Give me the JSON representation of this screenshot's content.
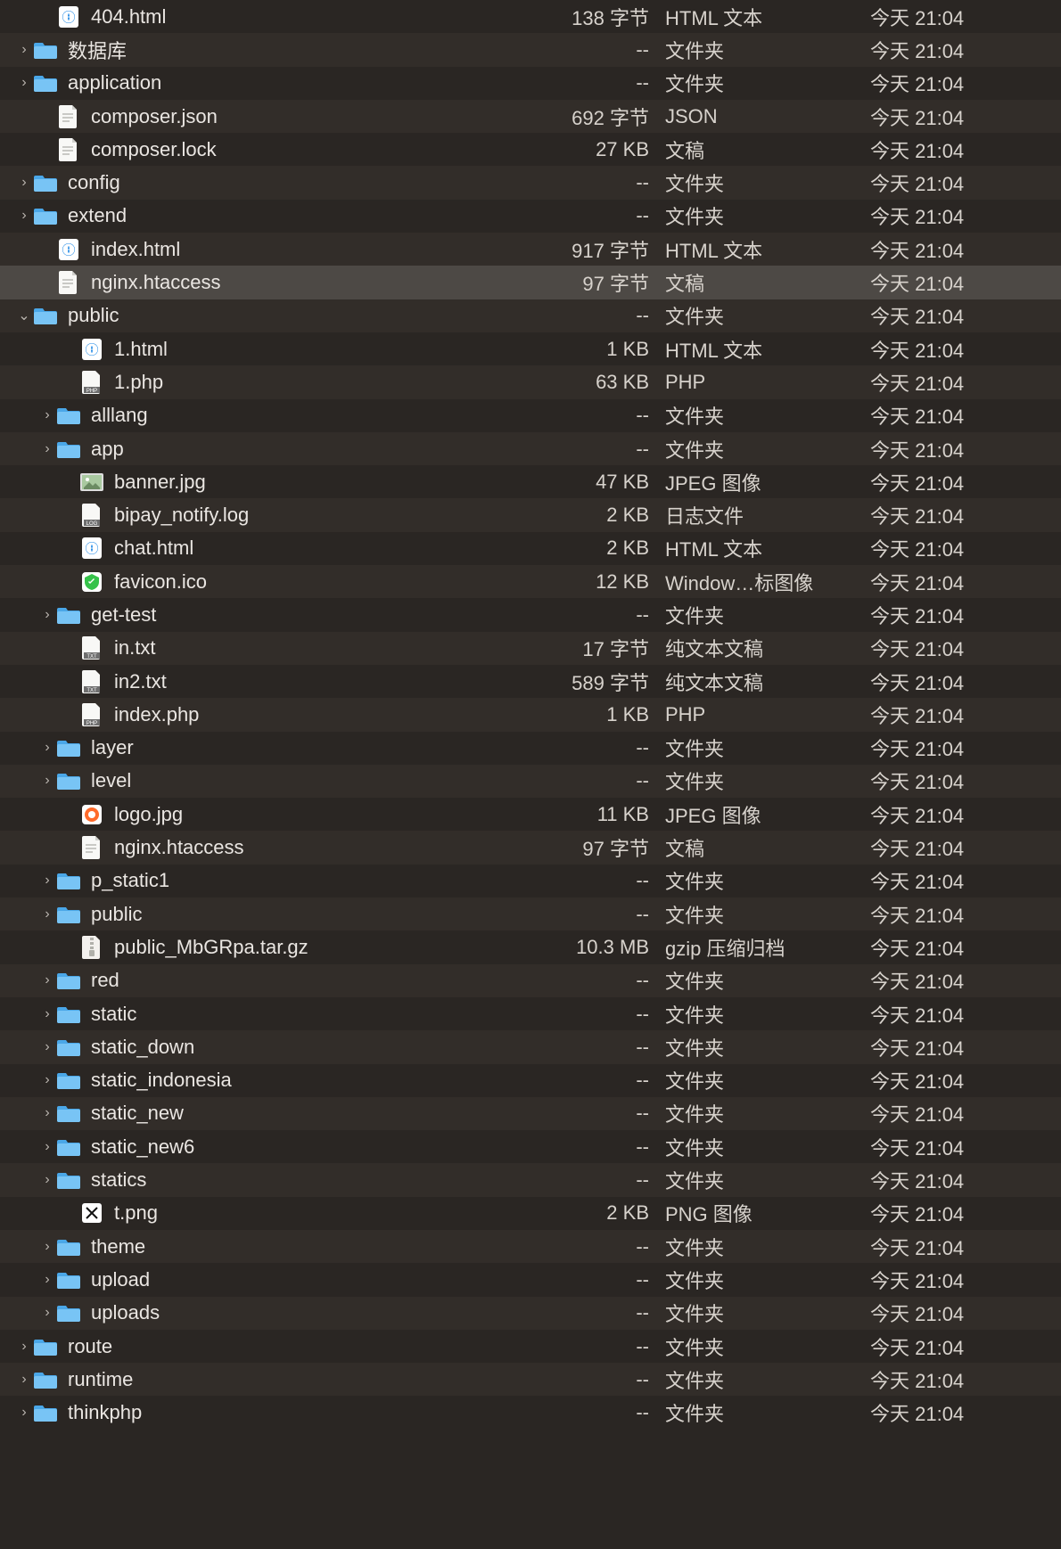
{
  "rows": [
    {
      "indent": 1,
      "expand": "none",
      "icon": "html",
      "name": "404.html",
      "size": "138 字节",
      "kind": "HTML 文本",
      "date": "今天 21:04"
    },
    {
      "indent": 0,
      "expand": "closed",
      "icon": "folder",
      "name": "数据库",
      "size": "--",
      "kind": "文件夹",
      "date": "今天 21:04"
    },
    {
      "indent": 0,
      "expand": "closed",
      "icon": "folder",
      "name": "application",
      "size": "--",
      "kind": "文件夹",
      "date": "今天 21:04"
    },
    {
      "indent": 1,
      "expand": "none",
      "icon": "doc",
      "name": "composer.json",
      "size": "692 字节",
      "kind": "JSON",
      "date": "今天 21:04"
    },
    {
      "indent": 1,
      "expand": "none",
      "icon": "doc",
      "name": "composer.lock",
      "size": "27 KB",
      "kind": "文稿",
      "date": "今天 21:04"
    },
    {
      "indent": 0,
      "expand": "closed",
      "icon": "folder",
      "name": "config",
      "size": "--",
      "kind": "文件夹",
      "date": "今天 21:04"
    },
    {
      "indent": 0,
      "expand": "closed",
      "icon": "folder",
      "name": "extend",
      "size": "--",
      "kind": "文件夹",
      "date": "今天 21:04"
    },
    {
      "indent": 1,
      "expand": "none",
      "icon": "html",
      "name": "index.html",
      "size": "917 字节",
      "kind": "HTML 文本",
      "date": "今天 21:04"
    },
    {
      "indent": 1,
      "expand": "none",
      "icon": "doc",
      "name": "nginx.htaccess",
      "size": "97 字节",
      "kind": "文稿",
      "date": "今天 21:04",
      "selected": true
    },
    {
      "indent": 0,
      "expand": "open",
      "icon": "folder",
      "name": "public",
      "size": "--",
      "kind": "文件夹",
      "date": "今天 21:04"
    },
    {
      "indent": 2,
      "expand": "none",
      "icon": "html",
      "name": "1.html",
      "size": "1 KB",
      "kind": "HTML 文本",
      "date": "今天 21:04"
    },
    {
      "indent": 2,
      "expand": "none",
      "icon": "php",
      "name": "1.php",
      "size": "63 KB",
      "kind": "PHP",
      "date": "今天 21:04"
    },
    {
      "indent": 1,
      "expand": "closed",
      "icon": "folder",
      "name": "alllang",
      "size": "--",
      "kind": "文件夹",
      "date": "今天 21:04"
    },
    {
      "indent": 1,
      "expand": "closed",
      "icon": "folder",
      "name": "app",
      "size": "--",
      "kind": "文件夹",
      "date": "今天 21:04"
    },
    {
      "indent": 2,
      "expand": "none",
      "icon": "jpeg",
      "name": "banner.jpg",
      "size": "47 KB",
      "kind": "JPEG 图像",
      "date": "今天 21:04"
    },
    {
      "indent": 2,
      "expand": "none",
      "icon": "log",
      "name": "bipay_notify.log",
      "size": "2 KB",
      "kind": "日志文件",
      "date": "今天 21:04"
    },
    {
      "indent": 2,
      "expand": "none",
      "icon": "html",
      "name": "chat.html",
      "size": "2 KB",
      "kind": "HTML 文本",
      "date": "今天 21:04"
    },
    {
      "indent": 2,
      "expand": "none",
      "icon": "ico",
      "name": "favicon.ico",
      "size": "12 KB",
      "kind": "Window…标图像",
      "date": "今天 21:04"
    },
    {
      "indent": 1,
      "expand": "closed",
      "icon": "folder",
      "name": "get-test",
      "size": "--",
      "kind": "文件夹",
      "date": "今天 21:04"
    },
    {
      "indent": 2,
      "expand": "none",
      "icon": "txt",
      "name": "in.txt",
      "size": "17 字节",
      "kind": "纯文本文稿",
      "date": "今天 21:04"
    },
    {
      "indent": 2,
      "expand": "none",
      "icon": "txt",
      "name": "in2.txt",
      "size": "589 字节",
      "kind": "纯文本文稿",
      "date": "今天 21:04"
    },
    {
      "indent": 2,
      "expand": "none",
      "icon": "php",
      "name": "index.php",
      "size": "1 KB",
      "kind": "PHP",
      "date": "今天 21:04"
    },
    {
      "indent": 1,
      "expand": "closed",
      "icon": "folder",
      "name": "layer",
      "size": "--",
      "kind": "文件夹",
      "date": "今天 21:04"
    },
    {
      "indent": 1,
      "expand": "closed",
      "icon": "folder",
      "name": "level",
      "size": "--",
      "kind": "文件夹",
      "date": "今天 21:04"
    },
    {
      "indent": 2,
      "expand": "none",
      "icon": "logo",
      "name": "logo.jpg",
      "size": "11 KB",
      "kind": "JPEG 图像",
      "date": "今天 21:04"
    },
    {
      "indent": 2,
      "expand": "none",
      "icon": "doc",
      "name": "nginx.htaccess",
      "size": "97 字节",
      "kind": "文稿",
      "date": "今天 21:04"
    },
    {
      "indent": 1,
      "expand": "closed",
      "icon": "folder",
      "name": "p_static1",
      "size": "--",
      "kind": "文件夹",
      "date": "今天 21:04"
    },
    {
      "indent": 1,
      "expand": "closed",
      "icon": "folder",
      "name": "public",
      "size": "--",
      "kind": "文件夹",
      "date": "今天 21:04"
    },
    {
      "indent": 2,
      "expand": "none",
      "icon": "gz",
      "name": "public_MbGRpa.tar.gz",
      "size": "10.3 MB",
      "kind": "gzip 压缩归档",
      "date": "今天 21:04"
    },
    {
      "indent": 1,
      "expand": "closed",
      "icon": "folder",
      "name": "red",
      "size": "--",
      "kind": "文件夹",
      "date": "今天 21:04"
    },
    {
      "indent": 1,
      "expand": "closed",
      "icon": "folder",
      "name": "static",
      "size": "--",
      "kind": "文件夹",
      "date": "今天 21:04"
    },
    {
      "indent": 1,
      "expand": "closed",
      "icon": "folder",
      "name": "static_down",
      "size": "--",
      "kind": "文件夹",
      "date": "今天 21:04"
    },
    {
      "indent": 1,
      "expand": "closed",
      "icon": "folder",
      "name": "static_indonesia",
      "size": "--",
      "kind": "文件夹",
      "date": "今天 21:04"
    },
    {
      "indent": 1,
      "expand": "closed",
      "icon": "folder",
      "name": "static_new",
      "size": "--",
      "kind": "文件夹",
      "date": "今天 21:04"
    },
    {
      "indent": 1,
      "expand": "closed",
      "icon": "folder",
      "name": "static_new6",
      "size": "--",
      "kind": "文件夹",
      "date": "今天 21:04"
    },
    {
      "indent": 1,
      "expand": "closed",
      "icon": "folder",
      "name": "statics",
      "size": "--",
      "kind": "文件夹",
      "date": "今天 21:04"
    },
    {
      "indent": 2,
      "expand": "none",
      "icon": "png",
      "name": "t.png",
      "size": "2 KB",
      "kind": "PNG 图像",
      "date": "今天 21:04"
    },
    {
      "indent": 1,
      "expand": "closed",
      "icon": "folder",
      "name": "theme",
      "size": "--",
      "kind": "文件夹",
      "date": "今天 21:04"
    },
    {
      "indent": 1,
      "expand": "closed",
      "icon": "folder",
      "name": "upload",
      "size": "--",
      "kind": "文件夹",
      "date": "今天 21:04"
    },
    {
      "indent": 1,
      "expand": "closed",
      "icon": "folder",
      "name": "uploads",
      "size": "--",
      "kind": "文件夹",
      "date": "今天 21:04"
    },
    {
      "indent": 0,
      "expand": "closed",
      "icon": "folder",
      "name": "route",
      "size": "--",
      "kind": "文件夹",
      "date": "今天 21:04"
    },
    {
      "indent": 0,
      "expand": "closed",
      "icon": "folder",
      "name": "runtime",
      "size": "--",
      "kind": "文件夹",
      "date": "今天 21:04"
    },
    {
      "indent": 0,
      "expand": "closed",
      "icon": "folder",
      "name": "thinkphp",
      "size": "--",
      "kind": "文件夹",
      "date": "今天 21:04"
    }
  ]
}
